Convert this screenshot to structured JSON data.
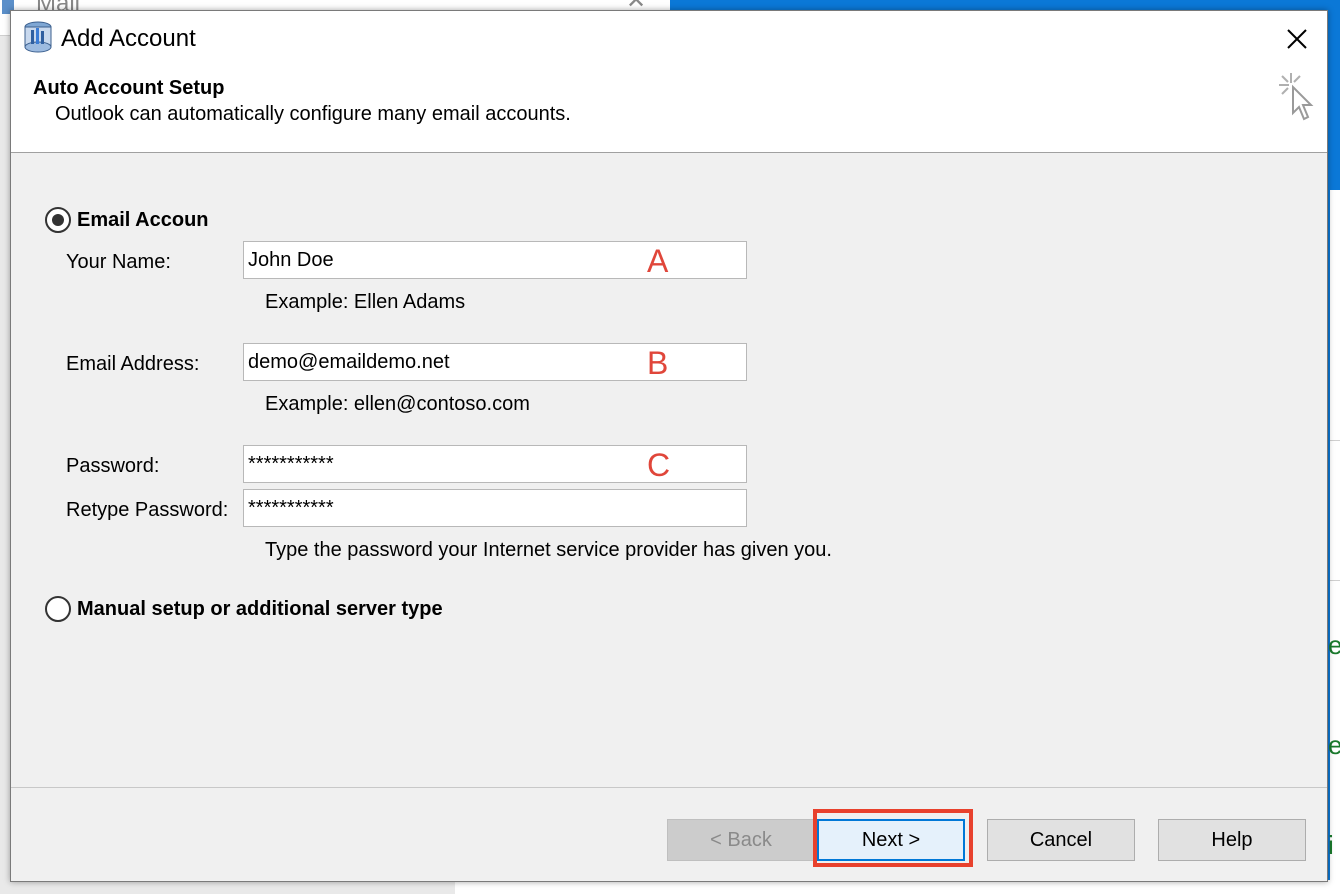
{
  "background": {
    "window_title": "Mail",
    "right_fragments": [
      "e",
      "e",
      "i"
    ]
  },
  "dialog": {
    "title": "Add Account",
    "section_title": "Auto Account Setup",
    "section_subtitle": "Outlook can automatically configure many email accounts."
  },
  "options": {
    "email_account_label": "Email Accoun",
    "email_account_selected": true,
    "manual_setup_label": "Manual setup or additional server type",
    "manual_setup_selected": false
  },
  "form": {
    "name_label": "Your Name:",
    "name_value": "John Doe",
    "name_hint": "Example: Ellen Adams",
    "email_label": "Email Address:",
    "email_value": "demo@emaildemo.net",
    "email_hint": "Example: ellen@contoso.com",
    "password_label": "Password:",
    "password_value": "***********",
    "retype_label": "Retype Password:",
    "retype_value": "***********",
    "password_hint": "Type the password your Internet service provider has given you."
  },
  "annotations": {
    "a": "A",
    "b": "B",
    "c": "C",
    "highlight_color": "#e8412d"
  },
  "buttons": {
    "back": "< Back",
    "next": "Next >",
    "cancel": "Cancel",
    "help": "Help"
  },
  "icons": {
    "title": "outlook-account-icon",
    "close": "close-icon",
    "wizard": "wizard-cursor-icon"
  }
}
